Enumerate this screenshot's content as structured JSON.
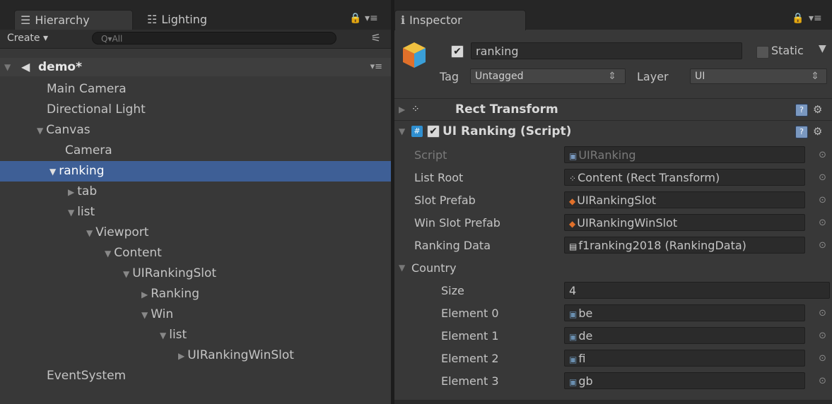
{
  "hierarchy": {
    "tab_label": "Hierarchy",
    "tab2_label": "Lighting",
    "create_label": "Create ▾",
    "search_placeholder": "Q▾All",
    "scene_name": "demo*",
    "items": [
      {
        "label": "Main Camera",
        "arrow": ""
      },
      {
        "label": "Directional Light",
        "arrow": ""
      },
      {
        "label": "Canvas",
        "arrow": "▼"
      },
      {
        "label": "Camera",
        "arrow": ""
      },
      {
        "label": "ranking",
        "arrow": "▼",
        "selected": true
      },
      {
        "label": "tab",
        "arrow": "▶"
      },
      {
        "label": "list",
        "arrow": "▼"
      },
      {
        "label": "Viewport",
        "arrow": "▼"
      },
      {
        "label": "Content",
        "arrow": "▼"
      },
      {
        "label": "UIRankingSlot",
        "arrow": "▼"
      },
      {
        "label": "Ranking",
        "arrow": "▶"
      },
      {
        "label": "Win",
        "arrow": "▼"
      },
      {
        "label": "list",
        "arrow": "▼"
      },
      {
        "label": "UIRankingWinSlot",
        "arrow": "▶"
      },
      {
        "label": "EventSystem",
        "arrow": ""
      }
    ]
  },
  "inspector": {
    "tab_label": "Inspector",
    "object_name": "ranking",
    "active_checked": "✔",
    "static_label": "Static",
    "tag_label": "Tag",
    "tag_value": "Untagged",
    "layer_label": "Layer",
    "layer_value": "UI",
    "rect_transform_title": "Rect Transform",
    "script_component_title": "UI Ranking (Script)",
    "script_checked": "✔",
    "properties": [
      {
        "label": "Script",
        "value": "UIRanking",
        "icon": "script"
      },
      {
        "label": "List Root",
        "value": "Content (Rect Transform)",
        "icon": "rect"
      },
      {
        "label": "Slot Prefab",
        "value": "UIRankingSlot",
        "icon": "prefab"
      },
      {
        "label": "Win Slot Prefab",
        "value": "UIRankingWinSlot",
        "icon": "prefab"
      },
      {
        "label": "Ranking Data",
        "value": "f1ranking2018 (RankingData)",
        "icon": "asset"
      }
    ],
    "country": {
      "label": "Country",
      "size_label": "Size",
      "size_value": "4",
      "elements": [
        {
          "label": "Element 0",
          "value": "be"
        },
        {
          "label": "Element 1",
          "value": "de"
        },
        {
          "label": "Element 2",
          "value": "fi"
        },
        {
          "label": "Element 3",
          "value": "gb"
        }
      ]
    }
  },
  "colors": {
    "selection": "#3e5f96",
    "panel_bg": "#383838",
    "field_bg": "#2b2b2b"
  }
}
